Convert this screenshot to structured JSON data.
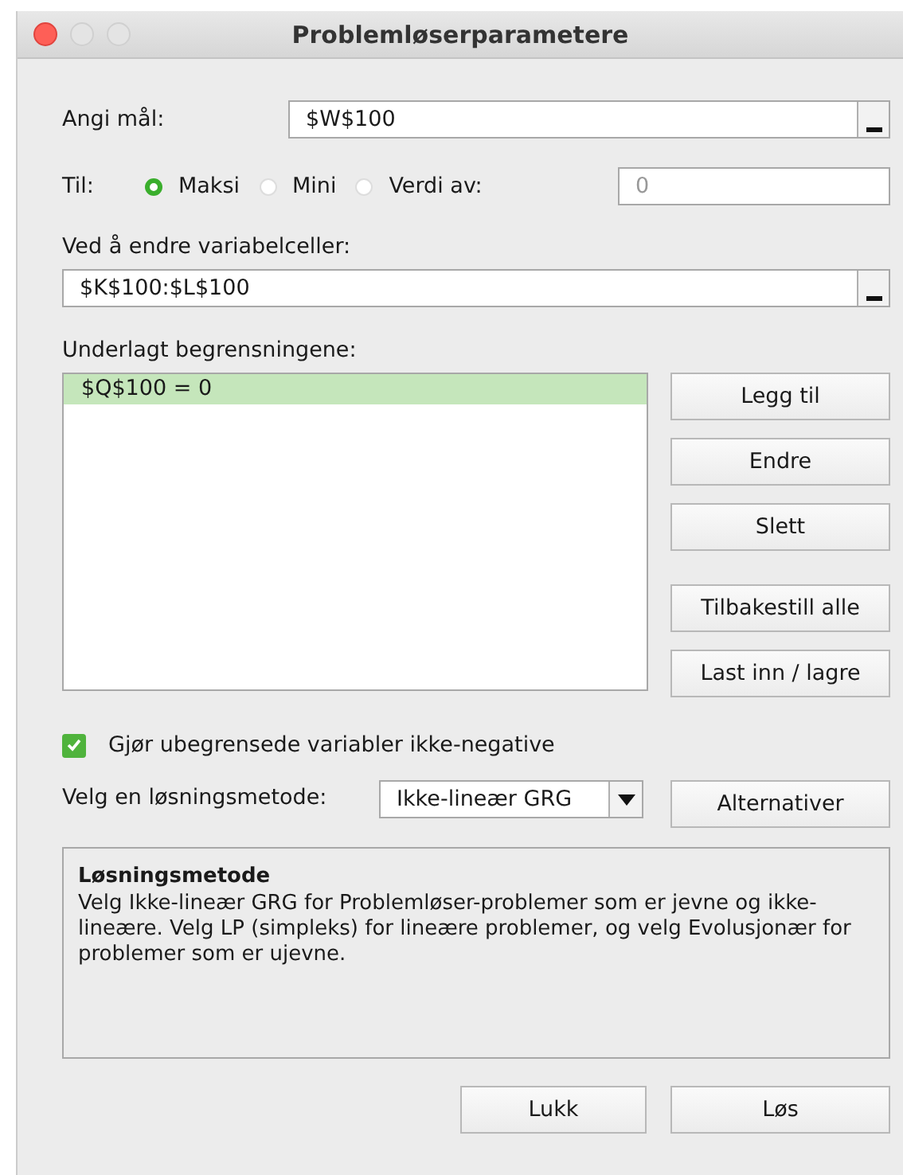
{
  "window": {
    "title": "Problemløserparametere"
  },
  "objective": {
    "label": "Angi mål:",
    "value": "$W$100"
  },
  "to": {
    "label": "Til:",
    "options": [
      {
        "label": "Maksi",
        "selected": true
      },
      {
        "label": "Mini",
        "selected": false
      },
      {
        "label": "Verdi av:",
        "selected": false
      }
    ],
    "value_placeholder": "0"
  },
  "variables": {
    "label": "Ved å endre variabelceller:",
    "value": "$K$100:$L$100"
  },
  "constraints": {
    "label": "Underlagt begrensningene:",
    "items": [
      {
        "text": "$Q$100 = 0",
        "selected": true
      }
    ],
    "buttons": [
      "Legg til",
      "Endre",
      "Slett",
      "Tilbakestill alle",
      "Last inn / lagre"
    ]
  },
  "nonnegative": {
    "label": "Gjør ubegrensede variabler ikke-negative",
    "checked": true
  },
  "method": {
    "label": "Velg en løsningsmetode:",
    "value": "Ikke-lineær GRG",
    "options_button": "Alternativer"
  },
  "description": {
    "title": "Løsningsmetode",
    "text": "Velg Ikke-lineær GRG for Problemløser-problemer som er jevne og ikke-lineære. Velg LP (simpleks) for lineære problemer, og velg Evolusjonær for problemer som er ujevne."
  },
  "footer_buttons": [
    "Lukk",
    "Løs"
  ]
}
